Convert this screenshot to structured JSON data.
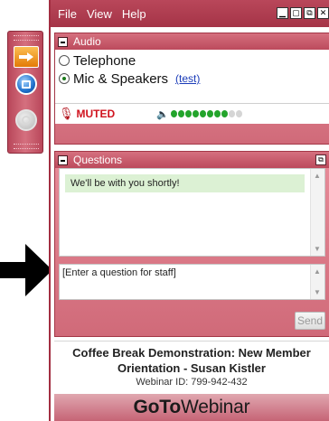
{
  "menubar": {
    "items": [
      "File",
      "View",
      "Help"
    ],
    "window_buttons": [
      "▁",
      "▢",
      "⧉",
      "✕"
    ]
  },
  "audio": {
    "header": "Audio",
    "telephone_label": "Telephone",
    "mic_label": "Mic & Speakers",
    "selected": "Mic & Speakers",
    "test_link": "(test)",
    "mic_status": "MUTED",
    "volume_level": 0.8
  },
  "questions": {
    "header": "Questions",
    "messages": [
      "We'll be with you shortly!"
    ],
    "input_value": "[Enter a question for staff]",
    "send_label": "Send"
  },
  "session": {
    "title": "Coffee Break Demonstration: New Member Orientation - Susan Kistler",
    "webinar_id": "Webinar ID: 799-942-432"
  },
  "brand": {
    "bold": "GoTo",
    "regular": "Webinar"
  },
  "colors": {
    "frame": "#b9475a",
    "muted": "#d0131e",
    "vu_on": "#23a42b",
    "message_bg": "#dcf1d4"
  },
  "icons": {
    "dock": [
      "arrow-right-icon",
      "screen-share-icon",
      "disabled-icon"
    ],
    "pointer": "pointer-arrow-icon"
  }
}
